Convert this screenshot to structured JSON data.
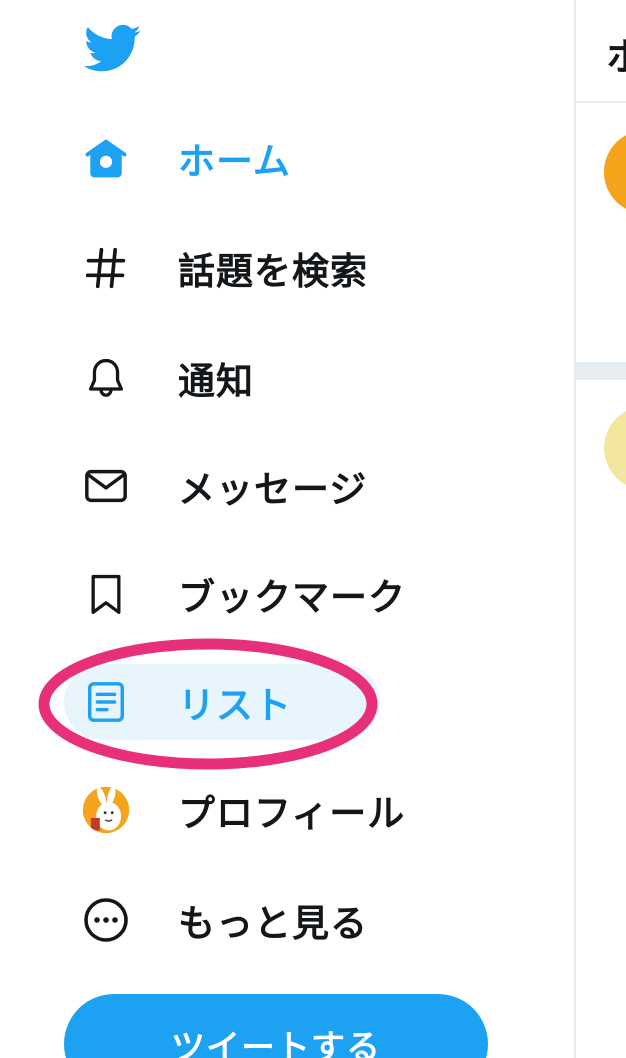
{
  "sidebar": {
    "items": [
      {
        "label": "ホーム",
        "icon": "home-icon",
        "state": "active"
      },
      {
        "label": "話題を検索",
        "icon": "hashtag-icon"
      },
      {
        "label": "通知",
        "icon": "bell-icon"
      },
      {
        "label": "メッセージ",
        "icon": "mail-icon"
      },
      {
        "label": "ブックマーク",
        "icon": "bookmark-icon"
      },
      {
        "label": "リスト",
        "icon": "list-icon",
        "state": "hover-highlighted"
      },
      {
        "label": "プロフィール",
        "icon": "avatar"
      },
      {
        "label": "もっと見る",
        "icon": "more-icon"
      }
    ],
    "tweet_button_label": "ツイートする"
  },
  "main": {
    "title_partial": "ホ"
  },
  "colors": {
    "accent": "#1da1f2",
    "text": "#14171a",
    "highlight_bg": "#e8f5fd",
    "annotation": "#e8307a",
    "divider": "#e6ecf0"
  }
}
